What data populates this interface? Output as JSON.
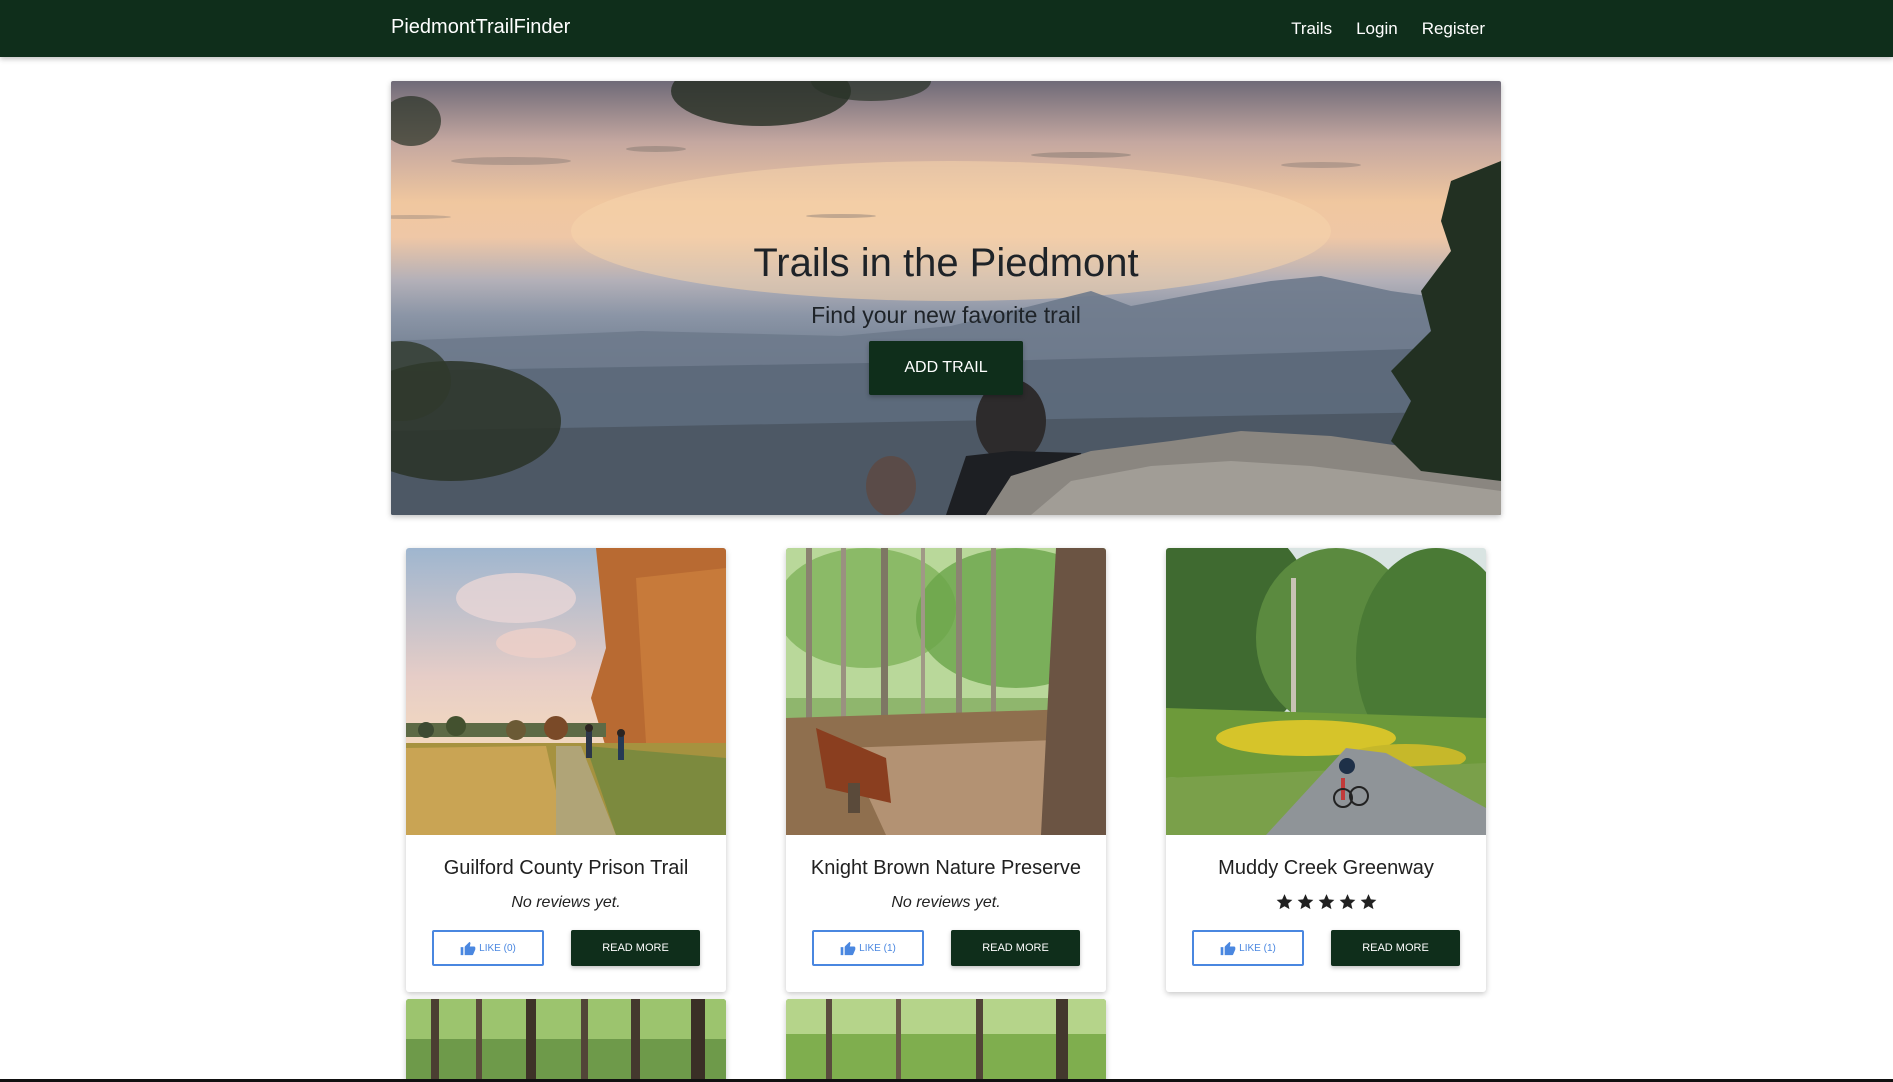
{
  "navbar": {
    "brand": "PiedmontTrailFinder",
    "links": [
      {
        "label": "Trails"
      },
      {
        "label": "Login"
      },
      {
        "label": "Register"
      }
    ]
  },
  "hero": {
    "title": "Trails in the Piedmont",
    "subtitle": "Find your new favorite trail",
    "button_label": "ADD TRAIL"
  },
  "cards": [
    {
      "title": "Guilford County Prison Trail",
      "review_text": "No reviews yet.",
      "rating": null,
      "like_label": "LIKE (0)",
      "readmore_label": "READ MORE"
    },
    {
      "title": "Knight Brown Nature Preserve",
      "review_text": "No reviews yet.",
      "rating": null,
      "like_label": "LIKE (1)",
      "readmore_label": "READ MORE"
    },
    {
      "title": "Muddy Creek Greenway",
      "review_text": "",
      "rating": 5,
      "like_label": "LIKE (1)",
      "readmore_label": "READ MORE"
    }
  ],
  "colors": {
    "nav_bg": "#0f2e1b",
    "primary_button": "#0f2e1b",
    "like_blue": "#4a87e0"
  },
  "icons": {
    "like": "thumbs-up-icon",
    "rating": "star-icon"
  }
}
